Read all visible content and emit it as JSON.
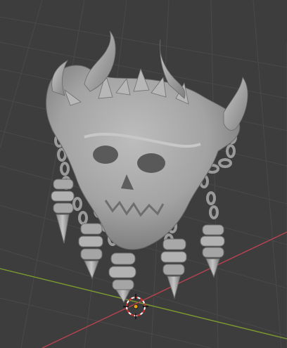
{
  "viewport": {
    "view": "3D Viewport",
    "shading": "solid",
    "background_color": "#3d3d3d",
    "grid_color": "#494949",
    "x_axis_color": "#b8434f",
    "y_axis_color": "#7b9a2e",
    "model_color": "#a9a9a9"
  },
  "scene": {
    "object": "demon-skull-sculpt",
    "origin_marker": "3d-cursor-icon"
  }
}
